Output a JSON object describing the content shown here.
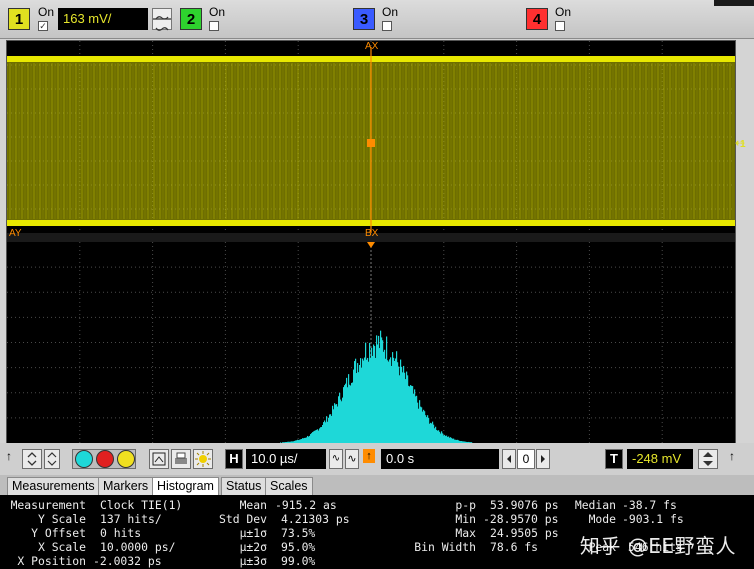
{
  "channels": [
    {
      "num": "1",
      "on_label": "On",
      "checked": true,
      "scale": "163 mV/",
      "color": "#e0e020"
    },
    {
      "num": "2",
      "on_label": "On",
      "checked": false,
      "color": "#2ed22e"
    },
    {
      "num": "3",
      "on_label": "On",
      "checked": false,
      "color": "#3a5bff"
    },
    {
      "num": "4",
      "on_label": "On",
      "checked": false,
      "color": "#ff3030"
    }
  ],
  "colors": {
    "trace": "#c8c800",
    "histogram": "#1ed8d8",
    "marker": "#ff8c00",
    "grid": "#4a4a4a"
  },
  "screen": {
    "marker_labels": {
      "ax_top": "AX",
      "ay": "AY",
      "bx": "BX",
      "ch_ref": "1"
    }
  },
  "controls": {
    "h_label": "H",
    "timebase": "10.0 µs/",
    "delay": "0.0 s",
    "zero": "0",
    "t_label": "T",
    "trigger_level": "-248 mV",
    "icons": [
      "arrows-icon",
      "updown-icon",
      "cyan-circle",
      "red-circle",
      "yellow-circle",
      "autoscale-icon",
      "printer-icon",
      "sun-icon",
      "waveform-icon",
      "trigger-icon"
    ]
  },
  "tabs": [
    "Measurements",
    "Markers",
    "Histogram",
    "Status",
    "Scales"
  ],
  "active_tab": "Histogram",
  "measurements": {
    "col1_labels": [
      "Measurement",
      "Y Scale",
      "Y Offset",
      "X Scale",
      "X Position"
    ],
    "col1_values": [
      "Clock TIE(1)",
      "137 hits/",
      "0 hits",
      "10.0000 ps/",
      "-2.0032 ps"
    ],
    "col2_labels": [
      "Mean",
      "Std Dev",
      "µ±1σ",
      "µ±2σ",
      "µ±3σ"
    ],
    "col2_values": [
      "-915.2 as",
      "4.21303 ps",
      "73.5%",
      "95.0%",
      "99.0%"
    ],
    "col3_labels": [
      "p-p",
      "Min",
      "Max",
      "Bin Width"
    ],
    "col3_values": [
      "53.9076 ps",
      "-28.9570 ps",
      "24.9505 ps",
      "78.6 fs"
    ],
    "col4_labels": [
      "Median",
      "Mode",
      "",
      "Peak"
    ],
    "col4_values": [
      "-38.7 fs",
      "-903.1 fs",
      "",
      "546 hits"
    ]
  },
  "watermark": "知乎 @EE野蛮人"
}
